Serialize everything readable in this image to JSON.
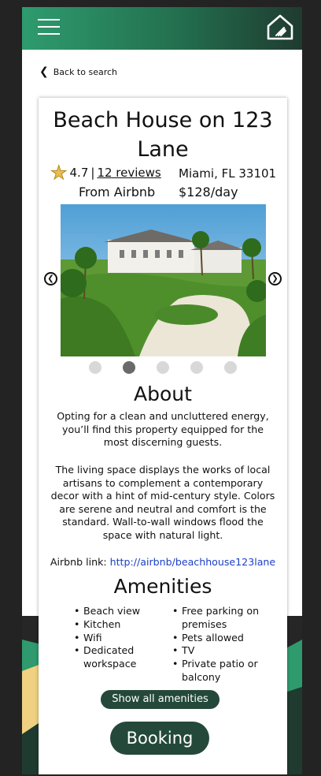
{
  "header": {
    "menu_icon": "hamburger-icon",
    "logo_icon": "house-logo-icon"
  },
  "nav": {
    "back_label": "Back to search"
  },
  "listing": {
    "title": "Beach House on 123 Lane",
    "rating": "4.7",
    "separator": "|",
    "reviews_label": "12 reviews",
    "location": "Miami, FL 33101",
    "source": "From Airbnb",
    "price": "$128/day",
    "carousel": {
      "total": 5,
      "active_index": 1
    }
  },
  "about": {
    "heading": "About",
    "paragraph1": "Opting for a clean and uncluttered energy, you’ll find this property equipped for the most discerning guests.",
    "paragraph2": "The living space displays the works of local artisans to complement a contemporary decor with a hint of mid-century style. Colors are serene and neutral and comfort is the standard. Wall-to-wall windows flood the space with natural light.",
    "link_label": "Airbnb link:",
    "link_url": "http://airbnb/beachhouse123lane"
  },
  "amenities": {
    "heading": "Amenities",
    "left": [
      "Beach view",
      "Kitchen",
      "Wifi",
      "Dedicated workspace"
    ],
    "right": [
      "Free parking on premises",
      "Pets allowed",
      "TV",
      "Private patio or balcony"
    ],
    "show_all_label": "Show all amenities"
  },
  "booking": {
    "label": "Booking"
  },
  "colors": {
    "header_green": "#2e9b6e",
    "button_green": "#24493a",
    "link_blue": "#1a3fc7",
    "star": "#e8c04f"
  }
}
